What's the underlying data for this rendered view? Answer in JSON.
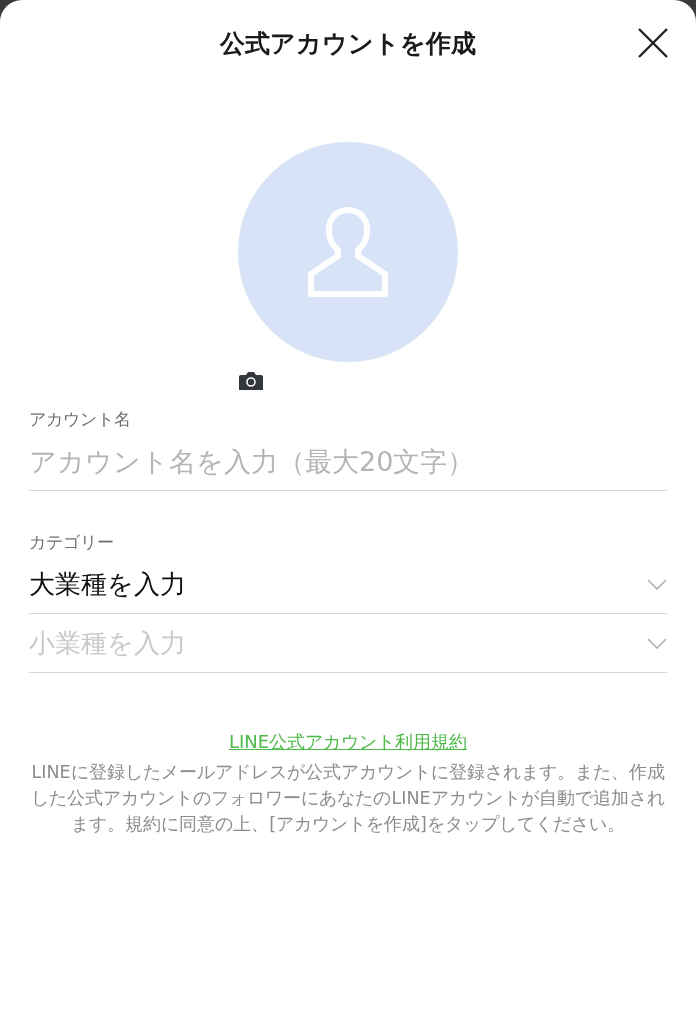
{
  "header": {
    "title": "公式アカウントを作成"
  },
  "fields": [
    {
      "kind": "text-input",
      "label": "アカウント名",
      "placeholder": "アカウント名を入力（最大20文字）"
    },
    {
      "kind": "select",
      "label": "カテゴリー",
      "value": "大業種を入力"
    },
    {
      "kind": "select",
      "placeholder": "小業種を入力"
    }
  ],
  "terms_link": "LINE公式アカウント利用規約",
  "notice": "LINEに登録したメールアドレスが公式アカウントに登録されます。また、作成した公式アカウントのフォロワーにあなたのLINEアカウントが自動で追加されます。規約に同意の上、[アカウントを作成]をタップしてください。"
}
